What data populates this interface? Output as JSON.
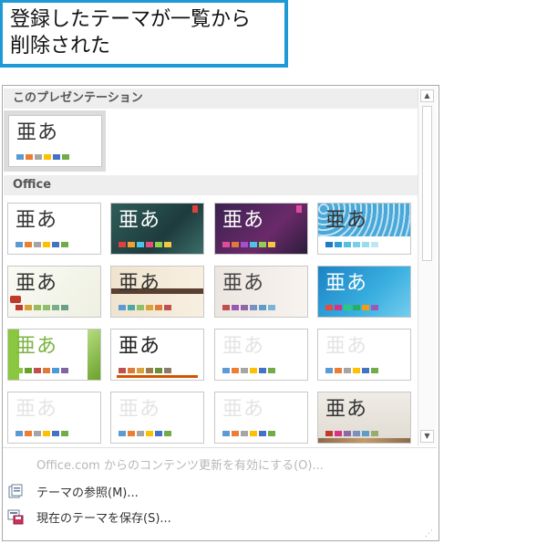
{
  "caption": {
    "line1": "登録したテーマが一覧から",
    "line2": "削除された"
  },
  "sections": {
    "this_presentation": "このプレゼンテーション",
    "office": "Office"
  },
  "thumb_text": "亜あ",
  "colors": {
    "palette_office": [
      "#5b9bd5",
      "#ed7d31",
      "#a5a5a5",
      "#ffc000",
      "#4472c4",
      "#70ad47"
    ],
    "accent_border": "#1d9ad6"
  },
  "menu": {
    "enable_updates": "Office.com からのコンテンツ更新を有効にする(O)...",
    "browse": "テーマの参照(M)...",
    "save": "現在のテーマを保存(S)..."
  },
  "icons": {
    "browse": "folder-browse-icon",
    "save": "save-theme-icon"
  }
}
